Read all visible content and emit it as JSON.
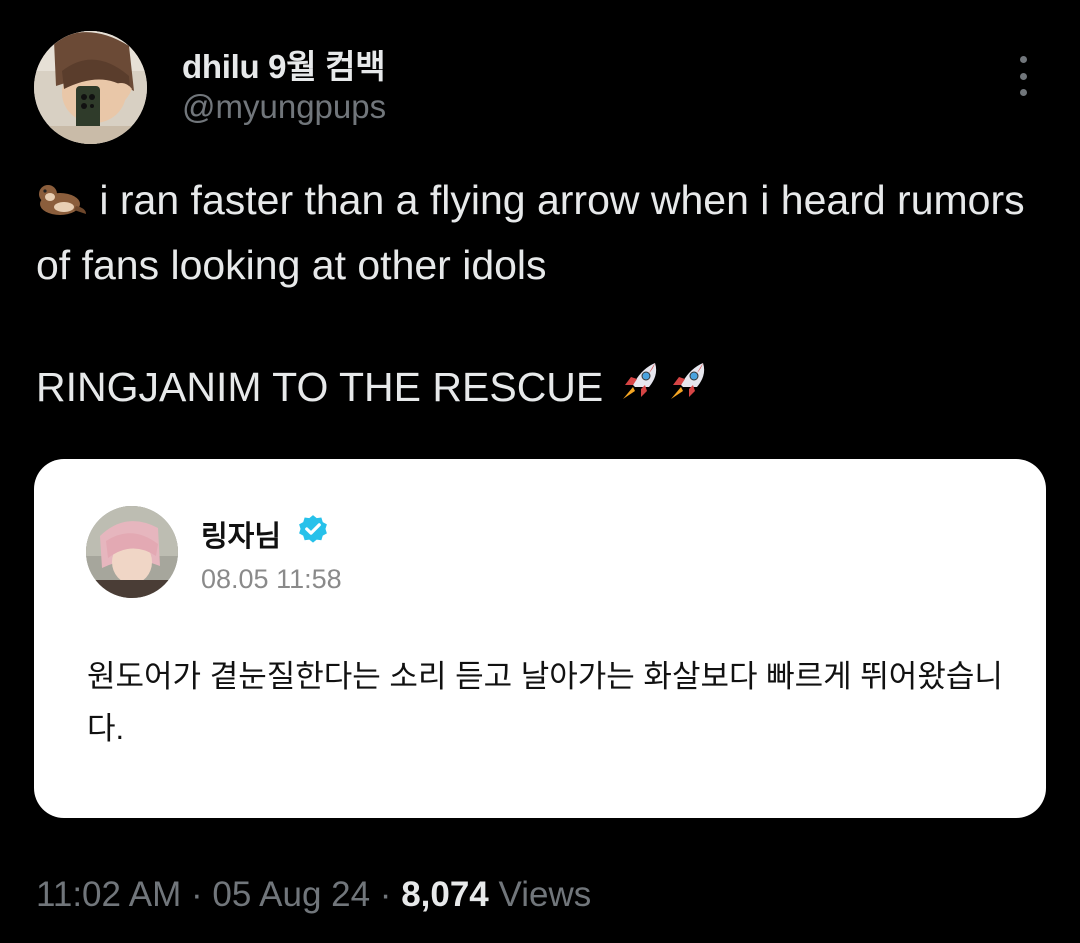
{
  "author": {
    "display_name": "dhilu 9월 컴백",
    "handle": "@myungpups",
    "more_icon": "more-vertical-icon"
  },
  "tweet": {
    "line1": "i ran faster than a flying arrow when i heard rumors of fans looking at other idols",
    "line2": "RINGJANIM TO THE RESCUE",
    "lead_emoji": "otter",
    "trail_emoji": "rocket"
  },
  "quoted_card": {
    "name": "링자님",
    "verified": true,
    "date": "08.05 11:58",
    "text": "원도어가 곁눈질한다는 소리 듣고 날아가는 화살보다 빠르게 뛰어왔습니다.",
    "accent": "#1d9bf0"
  },
  "meta": {
    "time": "11:02 AM",
    "sep": "·",
    "date": "05 Aug 24",
    "views_count": "8,074",
    "views_label": "Views"
  },
  "colors": {
    "background": "#000000",
    "text_primary": "#e7e9ea",
    "text_secondary": "#71767b",
    "card_bg": "#ffffff"
  }
}
